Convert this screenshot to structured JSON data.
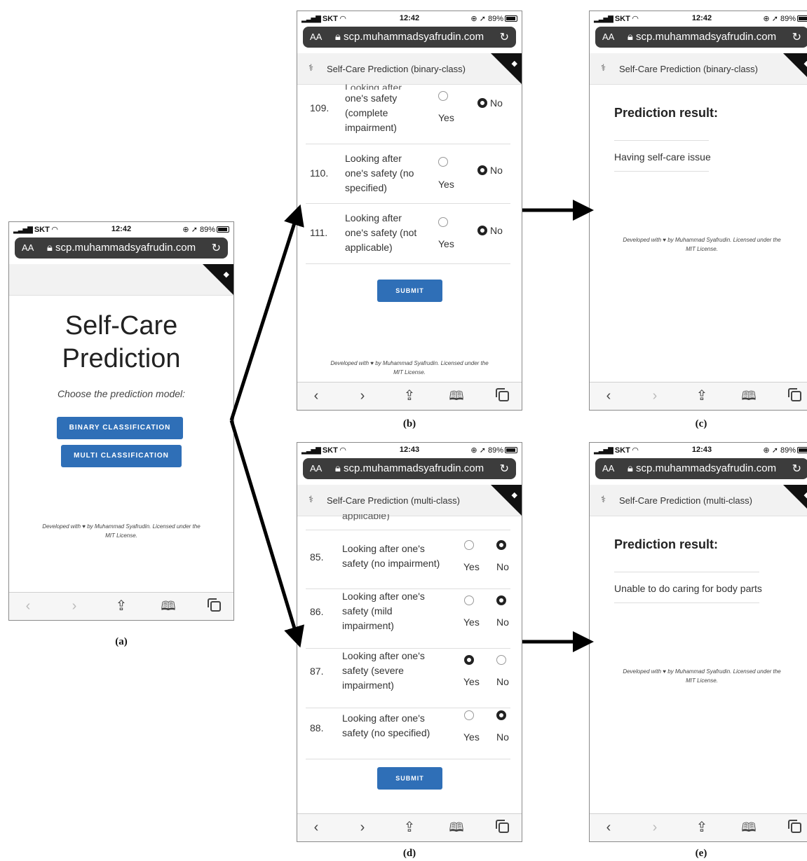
{
  "status": {
    "carrier": "SKT",
    "battery": "89%",
    "times": {
      "a": "12:42",
      "b": "12:42",
      "c": "12:42",
      "d": "12:43",
      "e": "12:43"
    }
  },
  "browser": {
    "aa": "AA",
    "url": "scp.muhammadsyafrudin.com"
  },
  "footer": {
    "line1": "Developed with ♥ by Muhammad Syafrudin. Licensed under the",
    "line2": "MIT License."
  },
  "screen_a": {
    "title_line1": "Self-Care",
    "title_line2": "Prediction",
    "subtitle": "Choose the prediction model:",
    "binary_button": "BINARY CLASSIFICATION",
    "multi_button": "MULTI CLASSIFICATION"
  },
  "screen_b": {
    "nav_title": "Self-Care Prediction (binary-class)",
    "partial_top": "Looking after",
    "rows": [
      {
        "num": "109.",
        "lines": [
          "one's safety",
          "(complete",
          "impairment)"
        ],
        "yes": "Yes",
        "no": "No",
        "selected": "No"
      },
      {
        "num": "110.",
        "lines": [
          "Looking after",
          "one's safety (no",
          "specified)"
        ],
        "yes": "Yes",
        "no": "No",
        "selected": "No"
      },
      {
        "num": "111.",
        "lines": [
          "Looking after",
          "one's safety (not",
          "applicable)"
        ],
        "yes": "Yes",
        "no": "No",
        "selected": "No"
      }
    ],
    "submit": "SUBMIT"
  },
  "screen_c": {
    "nav_title": "Self-Care Prediction (binary-class)",
    "result_title": "Prediction result:",
    "result_text": "Having self-care issue"
  },
  "screen_d": {
    "nav_title": "Self-Care Prediction (multi-class)",
    "partial_top": "applicable)",
    "rows": [
      {
        "num": "85.",
        "lines": [
          "Looking after one's",
          "safety (no impairment)"
        ],
        "yes": "Yes",
        "no": "No",
        "selected": "No"
      },
      {
        "num": "86.",
        "lines": [
          "Looking after one's",
          "safety (mild",
          "impairment)"
        ],
        "yes": "Yes",
        "no": "No",
        "selected": "No"
      },
      {
        "num": "87.",
        "lines": [
          "Looking after one's",
          "safety (severe",
          "impairment)"
        ],
        "yes": "Yes",
        "no": "No",
        "selected": "Yes"
      },
      {
        "num": "88.",
        "lines": [
          "Looking after one's",
          "safety (no specified)"
        ],
        "yes": "Yes",
        "no": "No",
        "selected": "No"
      }
    ],
    "submit": "SUBMIT"
  },
  "screen_e": {
    "nav_title": "Self-Care Prediction (multi-class)",
    "result_title": "Prediction result:",
    "result_text": "Unable to do caring for body parts"
  },
  "captions": {
    "a": "(a)",
    "b": "(b)",
    "c": "(c)",
    "d": "(d)",
    "e": "(e)"
  },
  "icons": {
    "signal": "signal-bars-icon",
    "wifi": "wifi-icon",
    "lock": "lock-icon",
    "reload": "reload-icon",
    "back": "back-icon",
    "forward": "forward-icon",
    "share": "share-icon",
    "bookmarks": "bookmarks-icon",
    "tabs": "tabs-icon",
    "app": "app-logo-icon"
  },
  "colors": {
    "accent": "#2f6fb7",
    "url_bar": "#3c3c3c",
    "corner": "#111111"
  }
}
